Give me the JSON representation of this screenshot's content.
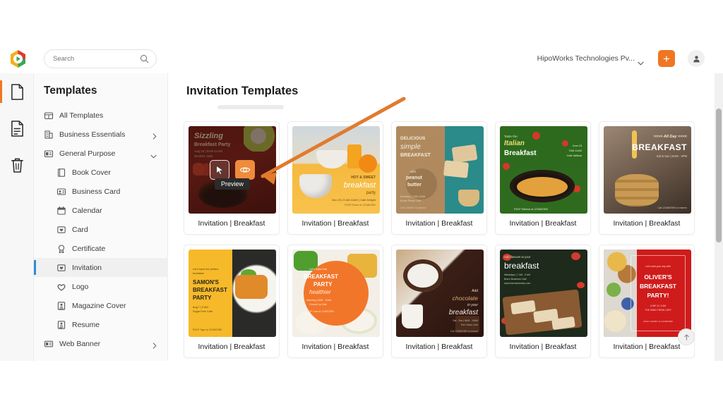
{
  "app": {
    "logo_icon": "hipo-logo-icon"
  },
  "topbar": {
    "search_placeholder": "Search",
    "search_value": "",
    "search_icon": "search-icon",
    "org_name": "HipoWorks Technologies Pv...",
    "org_chevron_icon": "chevron-down-icon",
    "add_label": "+",
    "add_icon": "plus-icon",
    "avatar_icon": "user-avatar-icon"
  },
  "rail": {
    "items": [
      {
        "icon": "document-blank-icon",
        "active": true
      },
      {
        "icon": "document-lines-icon",
        "active": false
      },
      {
        "icon": "trash-icon",
        "active": false
      }
    ]
  },
  "sidebar": {
    "title": "Templates",
    "items": [
      {
        "label": "All Templates",
        "icon": "grid-templates-icon",
        "level": 0,
        "arrow": "",
        "selected": false
      },
      {
        "label": "Business Essentials",
        "icon": "building-icon",
        "level": 0,
        "arrow": "right",
        "selected": false
      },
      {
        "label": "General Purpose",
        "icon": "list-card-icon",
        "level": 0,
        "arrow": "down",
        "selected": false
      },
      {
        "label": "Book Cover",
        "icon": "book-icon",
        "level": 1,
        "arrow": "",
        "selected": false
      },
      {
        "label": "Business Card",
        "icon": "id-card-icon",
        "level": 1,
        "arrow": "",
        "selected": false
      },
      {
        "label": "Calendar",
        "icon": "calendar-icon",
        "level": 1,
        "arrow": "",
        "selected": false
      },
      {
        "label": "Card",
        "icon": "card-heart-icon",
        "level": 1,
        "arrow": "",
        "selected": false
      },
      {
        "label": "Certificate",
        "icon": "certificate-icon",
        "level": 1,
        "arrow": "",
        "selected": false
      },
      {
        "label": "Invitation",
        "icon": "invitation-icon",
        "level": 1,
        "arrow": "",
        "selected": true
      },
      {
        "label": "Logo",
        "icon": "heart-icon",
        "level": 1,
        "arrow": "",
        "selected": false
      },
      {
        "label": "Magazine Cover",
        "icon": "magazine-icon",
        "level": 1,
        "arrow": "",
        "selected": false
      },
      {
        "label": "Resume",
        "icon": "resume-icon",
        "level": 1,
        "arrow": "",
        "selected": false
      },
      {
        "label": "Web Banner",
        "icon": "web-banner-icon",
        "level": 0,
        "arrow": "right",
        "selected": false
      }
    ]
  },
  "content": {
    "page_title": "Invitation Templates",
    "cards": [
      {
        "label": "Invitation | Breakfast",
        "art": "th1",
        "title_lines": [
          "Sizzling",
          "Breakfast Party",
          "Aug 24 | 9AM-11AM",
          "Smoker Cafe"
        ],
        "hovered": true
      },
      {
        "label": "Invitation | Breakfast",
        "art": "th2",
        "title_lines": [
          "HOT & SWEET",
          "breakfast",
          "party",
          "Nov 25 | 9 AM-11AM | Cafe Delight",
          "RSVP Robert at 1234567890"
        ],
        "hovered": false
      },
      {
        "label": "Invitation | Breakfast",
        "art": "th3",
        "title_lines": [
          "DELICIOUS",
          "simple",
          "BREAKFAST",
          "with",
          "peanut",
          "butter",
          "Mondays | 7AM-11AM",
          "Brown Bread Cafe",
          "Call 1234567 to reserve"
        ],
        "hovered": false
      },
      {
        "label": "Invitation | Breakfast",
        "art": "th4",
        "title_lines": [
          "Taste the",
          "Italian",
          "Breakfast",
          "June 18",
          "7AM-11AM",
          "Cafe Italiana",
          "RSVP Micheal at 1234567890"
        ],
        "hovered": false
      },
      {
        "label": "Invitation | Breakfast",
        "art": "th5",
        "title_lines": [
          ">>>> All Day <<<<",
          "BREAKFAST",
          "Sat & Sun | 8AM - 3PM",
          "Call 1234567890 to reserve"
        ],
        "hovered": false
      },
      {
        "label": "Invitation | Breakfast",
        "art": "th6",
        "title_lines": [
          "Let's have the perfect breakfast",
          "SAMON'S",
          "BREAKFAST",
          "PARTY",
          "Aug 7 | 9 AM",
          "Sugar Pine Cafe",
          "RSVP Tiger at 1234567890"
        ],
        "hovered": false
      },
      {
        "label": "Invitation | Breakfast",
        "art": "th7",
        "title_lines": [
          "Let's make this",
          "BREAKFAST",
          "PARTY",
          "healthier",
          "Saturday | 8AM - 11AM",
          "Ground Up Cafe",
          "RSVP Jessi at 1234567890"
        ],
        "hovered": false
      },
      {
        "label": "Invitation | Breakfast",
        "art": "th8",
        "title_lines": [
          "Add",
          "chocolate",
          "in your",
          "breakfast",
          "Sat - Sun | 8AM - 10AM",
          "The Choco Club",
          "Call 1234567890 to reserve"
        ],
        "hovered": false
      },
      {
        "label": "Invitation | Breakfast",
        "art": "th9",
        "title_lines": [
          "Add flavours to your",
          "breakfast",
          "Weekdays | 7 AM - 9 AM",
          "Bravo Business Cafe",
          "www.bravobusiness.com"
        ],
        "hovered": false
      },
      {
        "label": "Invitation | Breakfast",
        "art": "th10",
        "title_lines": [
          "Let's start your day with",
          "OLIVER'S",
          "BREAKFAST",
          "PARTY!",
          "JUNE 11 | 9 AM",
          "THE FAMILY BEAN CAFE",
          "RSVP 1234567 at 1234567890"
        ],
        "hovered": false
      }
    ],
    "preview_tooltip": "Preview",
    "preview_icon": "eye-icon",
    "cursor_icon": "cursor-arrow-icon",
    "scroll_top_icon": "arrow-up-icon"
  },
  "colors": {
    "accent_orange": "#ef7622",
    "selected_blue": "#2b8fd4",
    "preview_button": "#ef8b3c",
    "annotation_arrow": "#e07b2e"
  }
}
